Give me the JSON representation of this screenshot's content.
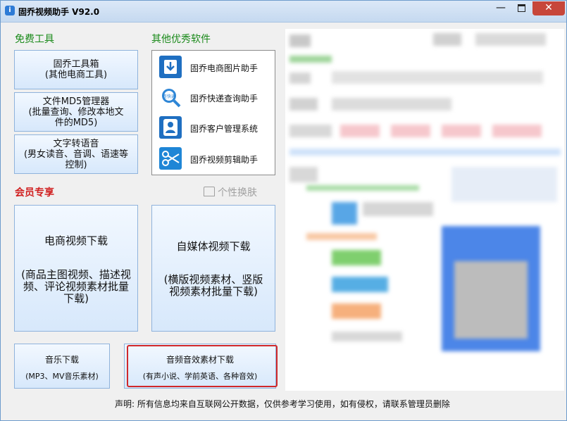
{
  "window": {
    "title": "固乔视频助手 V92.0",
    "icon": "app-icon"
  },
  "free_tools": {
    "heading": "免费工具",
    "buttons": [
      {
        "line1": "固乔工具箱",
        "line2": "(其他电商工具)"
      },
      {
        "line1": "文件MD5管理器",
        "line2": "(批量查询、修改本地文件的MD5)"
      },
      {
        "line1": "文字转语音",
        "line2": "(男女读音、音调、语速等控制)"
      }
    ]
  },
  "other_software": {
    "heading": "其他优秀软件",
    "items": [
      {
        "label": "固乔电商图片助手",
        "icon": "download-icon"
      },
      {
        "label": "固乔快递查询助手",
        "icon": "search-express-icon"
      },
      {
        "label": "固乔客户管理系统",
        "icon": "customer-icon"
      },
      {
        "label": "固乔视频剪辑助手",
        "icon": "scissors-icon"
      }
    ]
  },
  "member": {
    "heading": "会员专享",
    "skin_label": "个性换肤",
    "ecommerce": {
      "title": "电商视频下载",
      "desc": "(商品主图视频、描述视频、评论视频素材批量下载)"
    },
    "media": {
      "title": "自媒体视频下载",
      "desc": "(横版视频素材、竖版视频素材批量下载)"
    },
    "music": {
      "title": "音乐下载",
      "desc": "(MP3、MV音乐素材)"
    },
    "audio": {
      "title": "音频音效素材下载",
      "desc": "(有声小说、学前英语、各种音效)"
    }
  },
  "statement": "声明: 所有信息均来自互联网公开数据，仅供参考学习使用，如有侵权，请联系管理员删除",
  "colors": {
    "green_heading": "#1a8a1a",
    "red_heading": "#d02020",
    "highlight_border": "#d0282a",
    "button_border": "#8fb3dc"
  }
}
